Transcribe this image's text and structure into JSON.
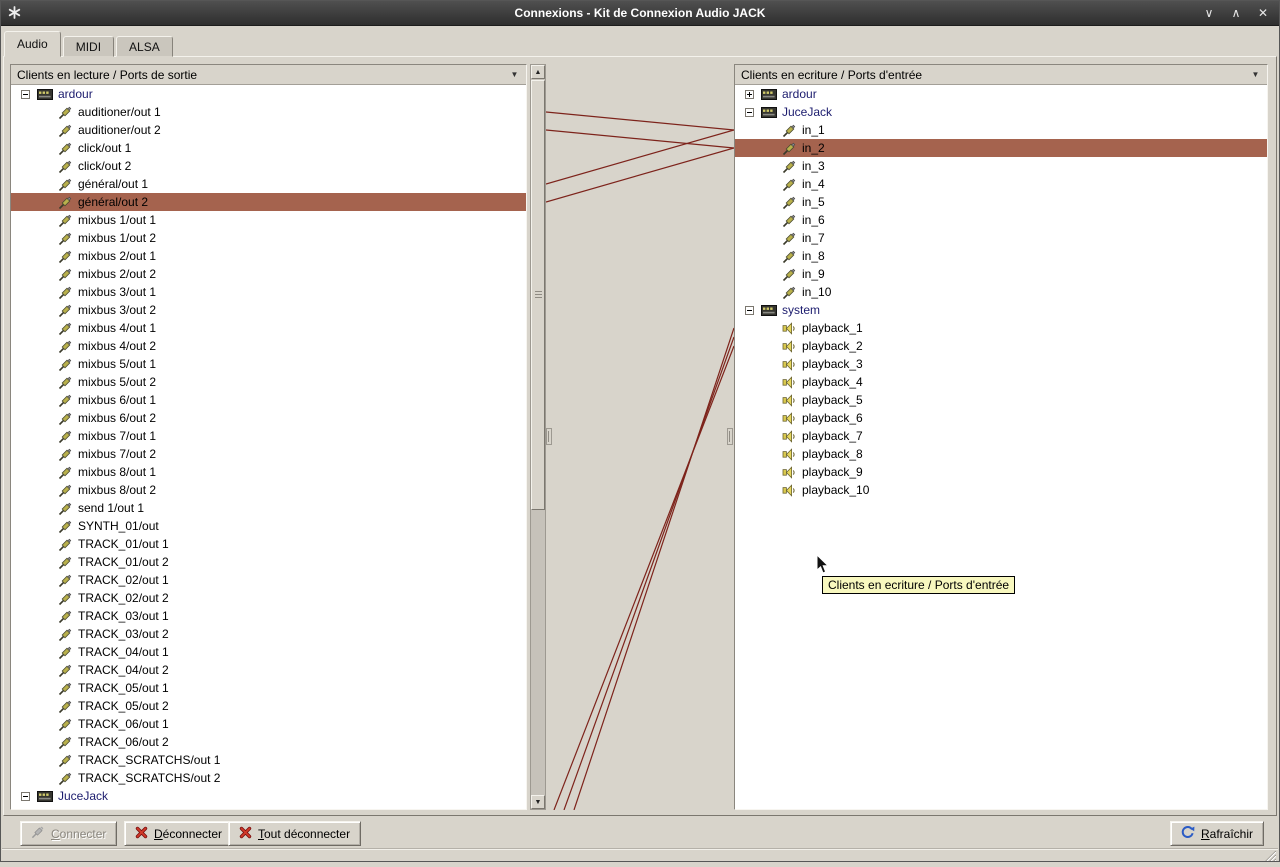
{
  "window": {
    "title": "Connexions - Kit de Connexion Audio JACK",
    "controls": {
      "minimize": "∨",
      "maximize": "∧",
      "close": "✕"
    }
  },
  "tabs": [
    {
      "label": "Audio",
      "active": true
    },
    {
      "label": "MIDI",
      "active": false
    },
    {
      "label": "ALSA",
      "active": false
    }
  ],
  "left_panel": {
    "header": "Clients en lecture / Ports de sortie",
    "items": [
      {
        "kind": "client",
        "label": "ardour",
        "expanded": true
      },
      {
        "kind": "port",
        "icon": "plug",
        "label": "auditioner/out 1"
      },
      {
        "kind": "port",
        "icon": "plug",
        "label": "auditioner/out 2"
      },
      {
        "kind": "port",
        "icon": "plug",
        "label": "click/out 1"
      },
      {
        "kind": "port",
        "icon": "plug",
        "label": "click/out 2"
      },
      {
        "kind": "port",
        "icon": "plug",
        "label": "général/out 1"
      },
      {
        "kind": "port",
        "icon": "plug",
        "label": "général/out 2",
        "selected": true
      },
      {
        "kind": "port",
        "icon": "plug",
        "label": "mixbus 1/out 1"
      },
      {
        "kind": "port",
        "icon": "plug",
        "label": "mixbus 1/out 2"
      },
      {
        "kind": "port",
        "icon": "plug",
        "label": "mixbus 2/out 1"
      },
      {
        "kind": "port",
        "icon": "plug",
        "label": "mixbus 2/out 2"
      },
      {
        "kind": "port",
        "icon": "plug",
        "label": "mixbus 3/out 1"
      },
      {
        "kind": "port",
        "icon": "plug",
        "label": "mixbus 3/out 2"
      },
      {
        "kind": "port",
        "icon": "plug",
        "label": "mixbus 4/out 1"
      },
      {
        "kind": "port",
        "icon": "plug",
        "label": "mixbus 4/out 2"
      },
      {
        "kind": "port",
        "icon": "plug",
        "label": "mixbus 5/out 1"
      },
      {
        "kind": "port",
        "icon": "plug",
        "label": "mixbus 5/out 2"
      },
      {
        "kind": "port",
        "icon": "plug",
        "label": "mixbus 6/out 1"
      },
      {
        "kind": "port",
        "icon": "plug",
        "label": "mixbus 6/out 2"
      },
      {
        "kind": "port",
        "icon": "plug",
        "label": "mixbus 7/out 1"
      },
      {
        "kind": "port",
        "icon": "plug",
        "label": "mixbus 7/out 2"
      },
      {
        "kind": "port",
        "icon": "plug",
        "label": "mixbus 8/out 1"
      },
      {
        "kind": "port",
        "icon": "plug",
        "label": "mixbus 8/out 2"
      },
      {
        "kind": "port",
        "icon": "plug",
        "label": "send 1/out 1"
      },
      {
        "kind": "port",
        "icon": "plug",
        "label": "SYNTH_01/out"
      },
      {
        "kind": "port",
        "icon": "plug",
        "label": "TRACK_01/out 1"
      },
      {
        "kind": "port",
        "icon": "plug",
        "label": "TRACK_01/out 2"
      },
      {
        "kind": "port",
        "icon": "plug",
        "label": "TRACK_02/out 1"
      },
      {
        "kind": "port",
        "icon": "plug",
        "label": "TRACK_02/out 2"
      },
      {
        "kind": "port",
        "icon": "plug",
        "label": "TRACK_03/out 1"
      },
      {
        "kind": "port",
        "icon": "plug",
        "label": "TRACK_03/out 2"
      },
      {
        "kind": "port",
        "icon": "plug",
        "label": "TRACK_04/out 1"
      },
      {
        "kind": "port",
        "icon": "plug",
        "label": "TRACK_04/out 2"
      },
      {
        "kind": "port",
        "icon": "plug",
        "label": "TRACK_05/out 1"
      },
      {
        "kind": "port",
        "icon": "plug",
        "label": "TRACK_05/out 2"
      },
      {
        "kind": "port",
        "icon": "plug",
        "label": "TRACK_06/out 1"
      },
      {
        "kind": "port",
        "icon": "plug",
        "label": "TRACK_06/out 2"
      },
      {
        "kind": "port",
        "icon": "plug",
        "label": "TRACK_SCRATCHS/out 1"
      },
      {
        "kind": "port",
        "icon": "plug",
        "label": "TRACK_SCRATCHS/out 2"
      },
      {
        "kind": "client",
        "label": "JuceJack",
        "expanded": true
      }
    ]
  },
  "right_panel": {
    "header": "Clients en ecriture / Ports d'entrée",
    "items": [
      {
        "kind": "client",
        "label": "ardour",
        "expanded": false
      },
      {
        "kind": "client",
        "label": "JuceJack",
        "expanded": true
      },
      {
        "kind": "port",
        "icon": "plug",
        "label": "in_1"
      },
      {
        "kind": "port",
        "icon": "plug",
        "label": "in_2",
        "selected": true
      },
      {
        "kind": "port",
        "icon": "plug",
        "label": "in_3"
      },
      {
        "kind": "port",
        "icon": "plug",
        "label": "in_4"
      },
      {
        "kind": "port",
        "icon": "plug",
        "label": "in_5"
      },
      {
        "kind": "port",
        "icon": "plug",
        "label": "in_6"
      },
      {
        "kind": "port",
        "icon": "plug",
        "label": "in_7"
      },
      {
        "kind": "port",
        "icon": "plug",
        "label": "in_8"
      },
      {
        "kind": "port",
        "icon": "plug",
        "label": "in_9"
      },
      {
        "kind": "port",
        "icon": "plug",
        "label": "in_10"
      },
      {
        "kind": "client",
        "label": "system",
        "expanded": true
      },
      {
        "kind": "port",
        "icon": "speaker",
        "label": "playback_1"
      },
      {
        "kind": "port",
        "icon": "speaker",
        "label": "playback_2"
      },
      {
        "kind": "port",
        "icon": "speaker",
        "label": "playback_3"
      },
      {
        "kind": "port",
        "icon": "speaker",
        "label": "playback_4"
      },
      {
        "kind": "port",
        "icon": "speaker",
        "label": "playback_5"
      },
      {
        "kind": "port",
        "icon": "speaker",
        "label": "playback_6"
      },
      {
        "kind": "port",
        "icon": "speaker",
        "label": "playback_7"
      },
      {
        "kind": "port",
        "icon": "speaker",
        "label": "playback_8"
      },
      {
        "kind": "port",
        "icon": "speaker",
        "label": "playback_9"
      },
      {
        "kind": "port",
        "icon": "speaker",
        "label": "playback_10"
      }
    ]
  },
  "tooltip": {
    "text": "Clients en ecriture / Ports d'entrée"
  },
  "buttons": {
    "connect": {
      "key": "C",
      "rest": "onnecter",
      "enabled": false
    },
    "disconnect": {
      "key": "D",
      "rest": "éconnecter",
      "enabled": true
    },
    "disconnect_all": {
      "key": "T",
      "rest": "out déconnecter",
      "enabled": true
    },
    "refresh": {
      "key": "R",
      "rest": "afraîchir",
      "enabled": true
    }
  },
  "icons": {
    "dropdown": "▼",
    "scroll_up": "▲",
    "scroll_down": "▼"
  },
  "colors": {
    "selection": "#a5634e",
    "connection_line": "#7d231b",
    "tooltip_bg": "#f8f8bf",
    "client_text": "#1c1c6e",
    "titlebar_text": "#ffffff"
  },
  "connections": {
    "lines": [
      [
        0,
        48,
        188,
        66
      ],
      [
        0,
        66,
        188,
        84
      ],
      [
        0,
        120,
        188,
        66
      ],
      [
        0,
        138,
        188,
        84
      ],
      [
        188,
        264,
        28,
        746
      ],
      [
        188,
        273,
        18,
        746
      ],
      [
        188,
        282,
        8,
        746
      ]
    ]
  }
}
